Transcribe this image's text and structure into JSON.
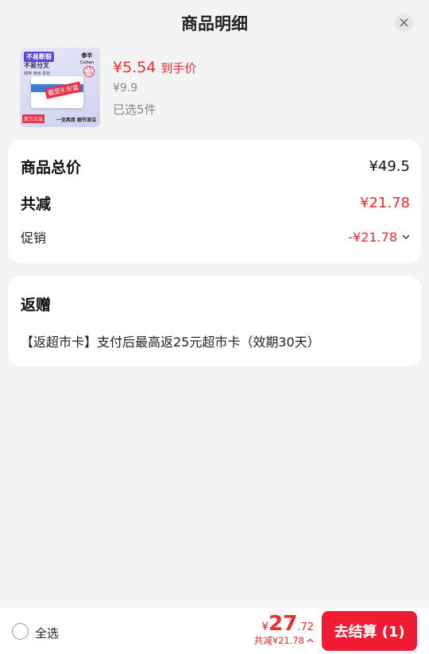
{
  "header": {
    "title": "商品明细"
  },
  "product": {
    "image": {
      "tag_top": "不易断裂",
      "tag_second": "不易分叉",
      "tag_third": "细棒 两用 柔韧",
      "brand": "参半",
      "brand_en": "Caiban",
      "promo": "截至9.9/盒",
      "badge": "1盒 50支",
      "foot_left": "官方正品",
      "foot_right": "一支两用 细节深洁"
    },
    "price_now": "¥5.54",
    "price_label": "到手价",
    "price_original": "¥9.9",
    "selected_text": "已选5件"
  },
  "summary": {
    "total_label": "商品总价",
    "total_value": "¥49.5",
    "reduce_label": "共减",
    "reduce_value": "¥21.78",
    "promo_label": "促销",
    "promo_value": "-¥21.78"
  },
  "gift": {
    "title": "返赠",
    "text": "【返超市卡】支付后最高返25元超市卡（效期30天）"
  },
  "bottom_bar": {
    "select_all": "全选",
    "currency": "¥",
    "amount_int": "27",
    "amount_dec": ".72",
    "discount_text": "共减¥21.78",
    "checkout_label": "去结算 (1)"
  },
  "colors": {
    "accent": "#ef1c33",
    "price_red": "#f12a2a",
    "background": "#f4f4f4"
  }
}
